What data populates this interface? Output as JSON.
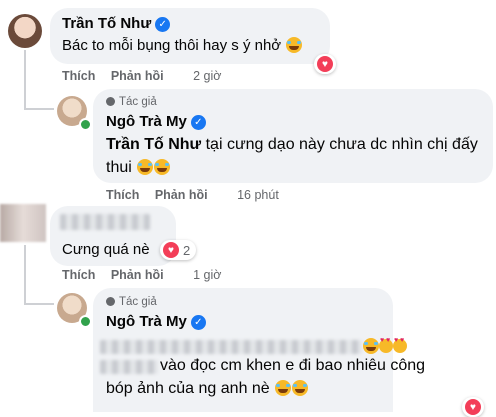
{
  "colors": {
    "accent": "#1877f2",
    "heart": "#f33e58",
    "bubble": "#f0f2f5",
    "muted": "#65676b"
  },
  "comments": [
    {
      "author": "Trần Tố Như",
      "verified_icon": "verified-badge-icon",
      "text": "Bác to mỗi bụng thôi hay s ý nhở",
      "actions": {
        "like": "Thích",
        "reply": "Phản hồi",
        "time": "2 giờ"
      },
      "reply": {
        "author_tag": "Tác giả",
        "author": "Ngô Trà My",
        "mention": "Trần Tố Như",
        "text_line1": "tại cưng dạo này chưa dc nhìn chị đấy",
        "text_line2": "thui",
        "actions": {
          "like": "Thích",
          "reply": "Phản hồi",
          "time": "16 phút"
        }
      }
    },
    {
      "author": "",
      "text": "Cưng quá nè",
      "reaction_count": "2",
      "actions": {
        "like": "Thích",
        "reply": "Phản hồi",
        "time": "1 giờ"
      },
      "reply": {
        "author_tag": "Tác giả",
        "author": "Ngô Trà My",
        "text_line2": "vào đọc cm khen e đi bao nhiêu công",
        "text_line3": "bóp ảnh của ng anh nè"
      }
    }
  ]
}
